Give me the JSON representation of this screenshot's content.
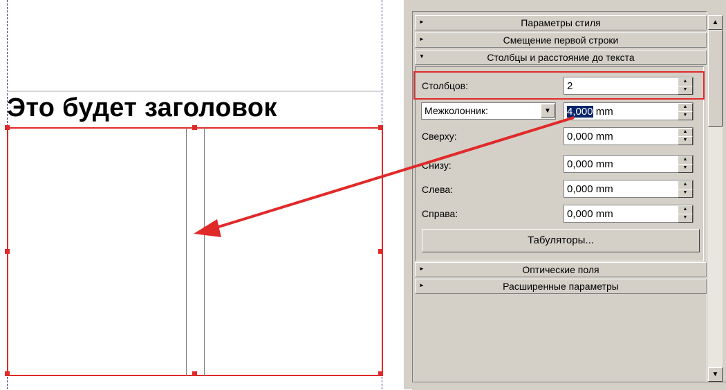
{
  "canvas": {
    "heading": "Это будет заголовок"
  },
  "panel": {
    "sections": {
      "style_params": "Параметры стиля",
      "first_line_offset": "Смещение первой строки",
      "columns_distances": "Столбцы и расстояние до текста",
      "optical_margins": "Оптические поля",
      "advanced": "Расширенные параметры"
    },
    "columns": {
      "label": "Столбцов:",
      "value": "2"
    },
    "gutter": {
      "selected_option": "Межколонник:",
      "value_selected": "4,000",
      "unit": " mm"
    },
    "top": {
      "label": "Сверху:",
      "value": "0,000  mm"
    },
    "bottom": {
      "label": "Снизу:",
      "value": "0,000  mm"
    },
    "left": {
      "label": "Слева:",
      "value": "0,000  mm"
    },
    "right": {
      "label": "Справа:",
      "value": "0,000  mm"
    },
    "tabs_button": "Табуляторы..."
  },
  "colors": {
    "annotation_red": "#e02a2a",
    "panel_bg": "#d4d0c8",
    "selection": "#0a246a"
  }
}
